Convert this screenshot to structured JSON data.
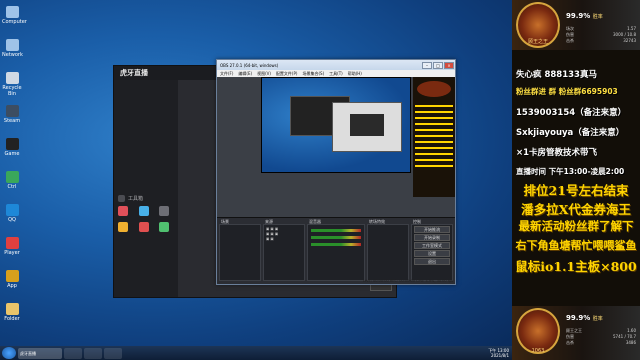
{
  "desktop": {
    "icons": [
      {
        "label": "Computer",
        "color": "#9fc3e8"
      },
      {
        "label": "Network",
        "color": "#9fc3e8"
      },
      {
        "label": "Recycle Bin",
        "color": "#cfd9e4"
      },
      {
        "label": "Steam",
        "color": "#3c4d62"
      },
      {
        "label": "Game",
        "color": "#222"
      },
      {
        "label": "Ctrl",
        "color": "#3aa75a"
      },
      {
        "label": "QQ",
        "color": "#1e88d8"
      },
      {
        "label": "Player",
        "color": "#e04040"
      },
      {
        "label": "App",
        "color": "#d7a01c"
      },
      {
        "label": "Folder",
        "color": "#e9c46a"
      }
    ]
  },
  "streamer_app": {
    "logo": "虎牙直播",
    "menu": [
      "工具箱",
      "",
      "",
      "",
      ""
    ]
  },
  "obs": {
    "title": "OBS 27.0.1 (64-bit, windows)",
    "menu": [
      "文件(F)",
      "编辑(E)",
      "视图(V)",
      "配置文件(P)",
      "场景集合(S)",
      "工具(T)",
      "帮助(H)"
    ],
    "panels": [
      "场景",
      "来源",
      "混音器",
      "转场特效",
      "控制"
    ],
    "controls": [
      "开始推流",
      "开始录制",
      "工作室模式",
      "设置",
      "退出"
    ],
    "status": "LIVE: 00:00:00  REC: 00:00:00  CPU: 4.9%, 30.00 fps"
  },
  "taskbar": {
    "active_label": "虎牙直播",
    "time": "下午 13:00",
    "date": "2021/8/1"
  },
  "right_panel": {
    "card1": {
      "name": "顾王之王",
      "pct": "99.9%",
      "pct_label": "胜率",
      "stats": [
        [
          "场次",
          "1.57"
        ],
        [
          "伤害",
          "3000 / 10.8"
        ],
        [
          "击杀",
          "32743"
        ]
      ]
    },
    "lines": [
      {
        "text": "失心疯  888133真马",
        "color": "#ffffff"
      },
      {
        "text": "粉丝群进  群  粉丝群6695903",
        "color": "#ffe043"
      },
      {
        "text": "1539003154（备注来意）",
        "color": "#ffffff"
      },
      {
        "text": "Sxkjiayouya（备注来意）",
        "color": "#ffffff"
      },
      {
        "text": "×1卡房管教技术带飞",
        "color": "#ffffff"
      },
      {
        "text": "直播时间 下午13:00-凌晨2:00",
        "color": "#ffffff"
      }
    ],
    "big_lines": [
      "排位21号左右结束",
      "潘多拉X代金券海王",
      "最新活动粉丝群了解下",
      "右下角鱼塘帮忙喂喂鲨鱼",
      "鼠标io1.1主板×800"
    ],
    "card2": {
      "name": "顾王之王",
      "pct": "99.9%",
      "pct_label": "胜率",
      "stats": [
        [
          "场次",
          "1.60"
        ],
        [
          "伤害",
          "5741 / 70.7"
        ],
        [
          "击杀",
          "3486"
        ]
      ],
      "level": "1063"
    }
  }
}
